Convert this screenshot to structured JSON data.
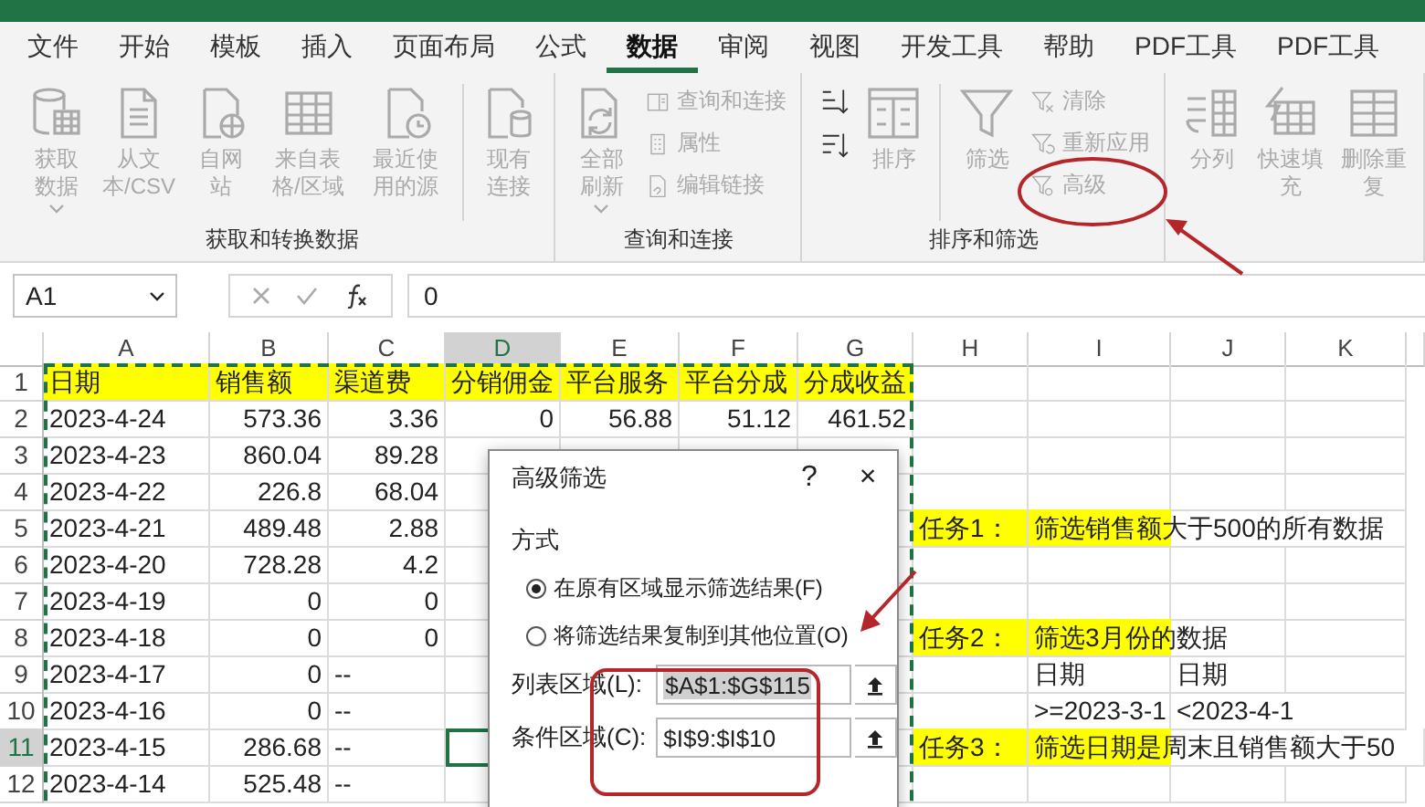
{
  "tabs": [
    {
      "label": "文件",
      "selected": false
    },
    {
      "label": "开始",
      "selected": false
    },
    {
      "label": "模板",
      "selected": false
    },
    {
      "label": "插入",
      "selected": false
    },
    {
      "label": "页面布局",
      "selected": false
    },
    {
      "label": "公式",
      "selected": false
    },
    {
      "label": "数据",
      "selected": true
    },
    {
      "label": "审阅",
      "selected": false
    },
    {
      "label": "视图",
      "selected": false
    },
    {
      "label": "开发工具",
      "selected": false
    },
    {
      "label": "帮助",
      "selected": false
    },
    {
      "label": "PDF工具",
      "selected": false
    },
    {
      "label": "PDF工具",
      "selected": false
    }
  ],
  "ribbon": {
    "groups": [
      {
        "label": "获取和转换数据",
        "buttons": [
          {
            "kind": "large",
            "label": "获取数据",
            "dropdown": true,
            "disabled": true,
            "separated": false
          },
          {
            "kind": "large",
            "label": "从文本/CSV",
            "dropdown": false,
            "disabled": true,
            "separated": false
          },
          {
            "kind": "large",
            "label": "自网站",
            "dropdown": false,
            "disabled": true,
            "separated": false
          },
          {
            "kind": "large",
            "label": "来自表格/区域",
            "dropdown": false,
            "disabled": true,
            "separated": false
          },
          {
            "kind": "large",
            "label": "最近使用的源",
            "dropdown": false,
            "disabled": true,
            "separated": false
          },
          {
            "kind": "large",
            "label": "现有连接",
            "dropdown": false,
            "disabled": true,
            "separated": true
          }
        ]
      },
      {
        "label": "查询和连接",
        "buttons": [
          {
            "kind": "large",
            "label": "全部刷新",
            "dropdown": true,
            "disabled": true,
            "separated": false
          },
          {
            "kind": "small",
            "label": "查询和连接",
            "disabled": true
          },
          {
            "kind": "small",
            "label": "属性",
            "disabled": true
          },
          {
            "kind": "small",
            "label": "编辑链接",
            "disabled": true
          }
        ]
      },
      {
        "label": "排序和筛选",
        "buttons": [
          {
            "kind": "icon",
            "disabled": false
          },
          {
            "kind": "icon",
            "disabled": false
          },
          {
            "kind": "large",
            "label": "排序",
            "dropdown": false,
            "disabled": true,
            "separated": false
          },
          {
            "kind": "large",
            "label": "筛选",
            "dropdown": false,
            "disabled": true,
            "separated": true
          },
          {
            "kind": "small",
            "label": "清除",
            "disabled": true
          },
          {
            "kind": "small",
            "label": "重新应用",
            "disabled": true
          },
          {
            "kind": "small",
            "label": "高级",
            "disabled": true
          }
        ]
      },
      {
        "buttons": [
          {
            "kind": "large",
            "label": "分列",
            "dropdown": false,
            "disabled": true,
            "separated": false
          },
          {
            "kind": "large",
            "label": "快速填充",
            "dropdown": false,
            "disabled": true,
            "separated": false
          },
          {
            "kind": "large",
            "label": "删除重复",
            "dropdown": false,
            "disabled": true,
            "separated": false
          }
        ]
      }
    ]
  },
  "formula_bar": {
    "name_box": "A1",
    "value": "0"
  },
  "sheet": {
    "columns": [
      {
        "label": "A",
        "selected": false
      },
      {
        "label": "B",
        "selected": false
      },
      {
        "label": "C",
        "selected": false
      },
      {
        "label": "D",
        "selected": true
      },
      {
        "label": "E",
        "selected": false
      },
      {
        "label": "F",
        "selected": false
      },
      {
        "label": "G",
        "selected": false
      },
      {
        "label": "H",
        "selected": false
      },
      {
        "label": "I",
        "selected": false
      },
      {
        "label": "J",
        "selected": false
      },
      {
        "label": "K",
        "selected": false
      }
    ],
    "rows": [
      {
        "number": "1",
        "selected": false,
        "cells": [
          {
            "text": "日期",
            "kind": "text",
            "highlight": true
          },
          {
            "text": "销售额",
            "kind": "text",
            "highlight": true
          },
          {
            "text": "渠道费",
            "kind": "text",
            "highlight": true
          },
          {
            "text": "分销佣金",
            "kind": "text",
            "highlight": true
          },
          {
            "text": "平台服务",
            "kind": "text",
            "highlight": true
          },
          {
            "text": "平台分成",
            "kind": "text",
            "highlight": true
          },
          {
            "text": "分成收益",
            "kind": "text",
            "highlight": true
          },
          null,
          null,
          null,
          null
        ]
      },
      {
        "number": "2",
        "selected": false,
        "cells": [
          {
            "text": "2023-4-24",
            "kind": "text",
            "highlight": false
          },
          {
            "text": "573.36",
            "kind": "number",
            "highlight": false
          },
          {
            "text": "3.36",
            "kind": "number",
            "highlight": false
          },
          {
            "text": "0",
            "kind": "number",
            "highlight": false
          },
          {
            "text": "56.88",
            "kind": "number",
            "highlight": false
          },
          {
            "text": "51.12",
            "kind": "number",
            "highlight": false
          },
          {
            "text": "461.52",
            "kind": "number",
            "highlight": false
          },
          null,
          null,
          null,
          null
        ]
      },
      {
        "number": "3",
        "selected": false,
        "cells": [
          {
            "text": "2023-4-23",
            "kind": "text",
            "highlight": false
          },
          {
            "text": "860.04",
            "kind": "number",
            "highlight": false
          },
          {
            "text": "89.28",
            "kind": "number",
            "highlight": false
          },
          null,
          null,
          null,
          null,
          null,
          null,
          null,
          null
        ]
      },
      {
        "number": "4",
        "selected": false,
        "cells": [
          {
            "text": "2023-4-22",
            "kind": "text",
            "highlight": false
          },
          {
            "text": "226.8",
            "kind": "number",
            "highlight": false
          },
          {
            "text": "68.04",
            "kind": "number",
            "highlight": false
          },
          null,
          null,
          null,
          null,
          null,
          null,
          null,
          null
        ]
      },
      {
        "number": "5",
        "selected": false,
        "cells": [
          {
            "text": "2023-4-21",
            "kind": "text",
            "highlight": false
          },
          {
            "text": "489.48",
            "kind": "number",
            "highlight": false
          },
          {
            "text": "2.88",
            "kind": "number",
            "highlight": false
          },
          null,
          null,
          null,
          null,
          {
            "text": "任务1：",
            "kind": "text",
            "highlight": true
          },
          {
            "text": "筛选销售额大于500的所有数据",
            "kind": "text",
            "highlight": true
          },
          null,
          null
        ]
      },
      {
        "number": "6",
        "selected": false,
        "cells": [
          {
            "text": "2023-4-20",
            "kind": "text",
            "highlight": false
          },
          {
            "text": "728.28",
            "kind": "number",
            "highlight": false
          },
          {
            "text": "4.2",
            "kind": "number",
            "highlight": false
          },
          null,
          null,
          null,
          null,
          null,
          null,
          null,
          null
        ]
      },
      {
        "number": "7",
        "selected": false,
        "cells": [
          {
            "text": "2023-4-19",
            "kind": "text",
            "highlight": false
          },
          {
            "text": "0",
            "kind": "number",
            "highlight": false
          },
          {
            "text": "0",
            "kind": "number",
            "highlight": false
          },
          null,
          null,
          null,
          null,
          null,
          null,
          null,
          null
        ]
      },
      {
        "number": "8",
        "selected": false,
        "cells": [
          {
            "text": "2023-4-18",
            "kind": "text",
            "highlight": false
          },
          {
            "text": "0",
            "kind": "number",
            "highlight": false
          },
          {
            "text": "0",
            "kind": "number",
            "highlight": false
          },
          null,
          null,
          null,
          null,
          {
            "text": "任务2：",
            "kind": "text",
            "highlight": true
          },
          {
            "text": "筛选3月份的数据",
            "kind": "text",
            "highlight": true
          },
          null,
          null
        ]
      },
      {
        "number": "9",
        "selected": false,
        "cells": [
          {
            "text": "2023-4-17",
            "kind": "text",
            "highlight": false
          },
          {
            "text": "0",
            "kind": "number",
            "highlight": false
          },
          {
            "text": "--",
            "kind": "text",
            "highlight": false
          },
          null,
          null,
          null,
          null,
          null,
          {
            "text": "日期",
            "kind": "text",
            "highlight": false
          },
          {
            "text": "日期",
            "kind": "text",
            "highlight": false
          },
          null
        ]
      },
      {
        "number": "10",
        "selected": false,
        "cells": [
          {
            "text": "2023-4-16",
            "kind": "text",
            "highlight": false
          },
          {
            "text": "0",
            "kind": "number",
            "highlight": false
          },
          {
            "text": "--",
            "kind": "text",
            "highlight": false
          },
          null,
          null,
          null,
          null,
          null,
          {
            "text": ">=2023-3-1",
            "kind": "text",
            "highlight": false
          },
          {
            "text": "<2023-4-1",
            "kind": "text",
            "highlight": false
          },
          null
        ]
      },
      {
        "number": "11",
        "selected": true,
        "cells": [
          {
            "text": "2023-4-15",
            "kind": "text",
            "highlight": false
          },
          {
            "text": "286.68",
            "kind": "number",
            "highlight": false
          },
          {
            "text": "--",
            "kind": "text",
            "highlight": false
          },
          null,
          null,
          null,
          null,
          {
            "text": "任务3：",
            "kind": "text",
            "highlight": true
          },
          {
            "text": "筛选日期是周末且销售额大于50",
            "kind": "text",
            "highlight": true
          },
          null,
          null
        ]
      },
      {
        "number": "12",
        "selected": false,
        "cells": [
          {
            "text": "2023-4-14",
            "kind": "text",
            "highlight": false
          },
          {
            "text": "525.48",
            "kind": "number",
            "highlight": false
          },
          {
            "text": "--",
            "kind": "text",
            "highlight": false
          },
          null,
          null,
          null,
          null,
          null,
          null,
          null,
          null
        ]
      }
    ]
  },
  "dialog": {
    "title": "高级筛选",
    "help_button": "?",
    "close_button": "×",
    "section": "方式",
    "options": [
      {
        "label": "在原有区域显示筛选结果(F)",
        "selected": true
      },
      {
        "label": "将筛选结果复制到其他位置(O)",
        "selected": false
      }
    ],
    "fields": [
      {
        "label": "列表区域(L):",
        "value": "$A$1:$G$115",
        "selected": true
      },
      {
        "label": "条件区域(C):",
        "value": "$I$9:$I$10",
        "selected": false
      }
    ]
  }
}
